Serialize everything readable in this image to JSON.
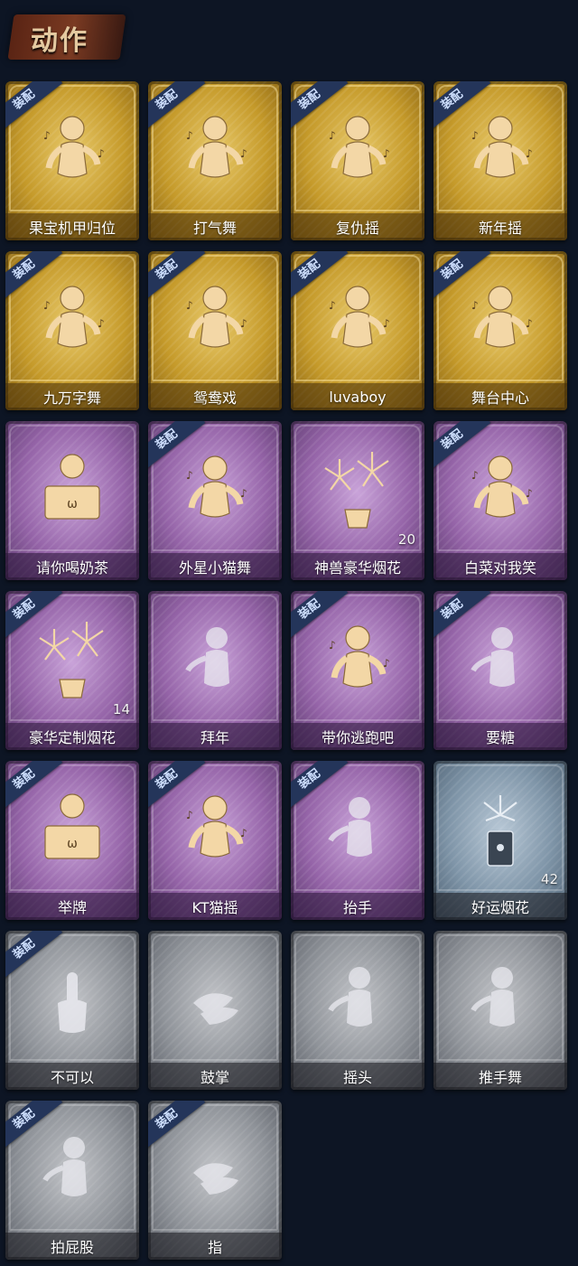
{
  "header": {
    "title": "动作"
  },
  "badge_text": "装配",
  "cards": [
    {
      "label": "果宝机甲归位",
      "rarity": "gold",
      "equipped": true,
      "icon": "dance-pose-icon",
      "count": ""
    },
    {
      "label": "打气舞",
      "rarity": "gold",
      "equipped": true,
      "icon": "dance-pose-icon",
      "count": ""
    },
    {
      "label": "复仇摇",
      "rarity": "gold",
      "equipped": true,
      "icon": "dance-pose-icon",
      "count": ""
    },
    {
      "label": "新年摇",
      "rarity": "gold",
      "equipped": true,
      "icon": "dance-pose-icon",
      "count": ""
    },
    {
      "label": "九万字舞",
      "rarity": "gold",
      "equipped": true,
      "icon": "dance-pose-icon",
      "count": ""
    },
    {
      "label": "鸳鸯戏",
      "rarity": "gold",
      "equipped": true,
      "icon": "dance-pose-icon",
      "count": ""
    },
    {
      "label": "luvaboy",
      "rarity": "gold",
      "equipped": true,
      "icon": "dance-pose-icon",
      "count": ""
    },
    {
      "label": "舞台中心",
      "rarity": "gold",
      "equipped": true,
      "icon": "dance-pose-icon",
      "count": ""
    },
    {
      "label": "请你喝奶茶",
      "rarity": "purple",
      "equipped": false,
      "icon": "sign-holder-icon",
      "count": ""
    },
    {
      "label": "外星小猫舞",
      "rarity": "purple",
      "equipped": true,
      "icon": "dance-pose-icon",
      "count": ""
    },
    {
      "label": "神兽豪华烟花",
      "rarity": "purple",
      "equipped": false,
      "icon": "fireworks-icon",
      "count": "20"
    },
    {
      "label": "白菜对我笑",
      "rarity": "purple",
      "equipped": true,
      "icon": "dance-pose-icon",
      "count": ""
    },
    {
      "label": "豪华定制烟花",
      "rarity": "purple",
      "equipped": true,
      "icon": "fireworks-icon",
      "count": "14"
    },
    {
      "label": "拜年",
      "rarity": "purple",
      "equipped": false,
      "icon": "figure-faded-icon",
      "count": ""
    },
    {
      "label": "带你逃跑吧",
      "rarity": "purple",
      "equipped": true,
      "icon": "dance-pose-icon",
      "count": ""
    },
    {
      "label": "要糖",
      "rarity": "purple",
      "equipped": true,
      "icon": "figure-faded-icon",
      "count": ""
    },
    {
      "label": "举牌",
      "rarity": "purple",
      "equipped": true,
      "icon": "sign-holder-icon",
      "count": ""
    },
    {
      "label": "KT猫摇",
      "rarity": "purple",
      "equipped": true,
      "icon": "dance-pose-icon",
      "count": ""
    },
    {
      "label": "抬手",
      "rarity": "purple",
      "equipped": true,
      "icon": "figure-faded-icon",
      "count": ""
    },
    {
      "label": "好运烟花",
      "rarity": "blue",
      "equipped": false,
      "icon": "firework-can-icon",
      "count": "42"
    },
    {
      "label": "不可以",
      "rarity": "gray",
      "equipped": true,
      "icon": "finger-icon",
      "count": ""
    },
    {
      "label": "鼓掌",
      "rarity": "gray",
      "equipped": false,
      "icon": "clap-icon",
      "count": ""
    },
    {
      "label": "摇头",
      "rarity": "gray",
      "equipped": false,
      "icon": "figure-faded-icon",
      "count": ""
    },
    {
      "label": "推手舞",
      "rarity": "gray",
      "equipped": false,
      "icon": "figure-faded-icon",
      "count": ""
    },
    {
      "label": "拍屁股",
      "rarity": "gray",
      "equipped": true,
      "icon": "figure-faded-icon",
      "count": ""
    },
    {
      "label": "指",
      "rarity": "gray",
      "equipped": true,
      "icon": "clap-icon",
      "count": ""
    }
  ]
}
